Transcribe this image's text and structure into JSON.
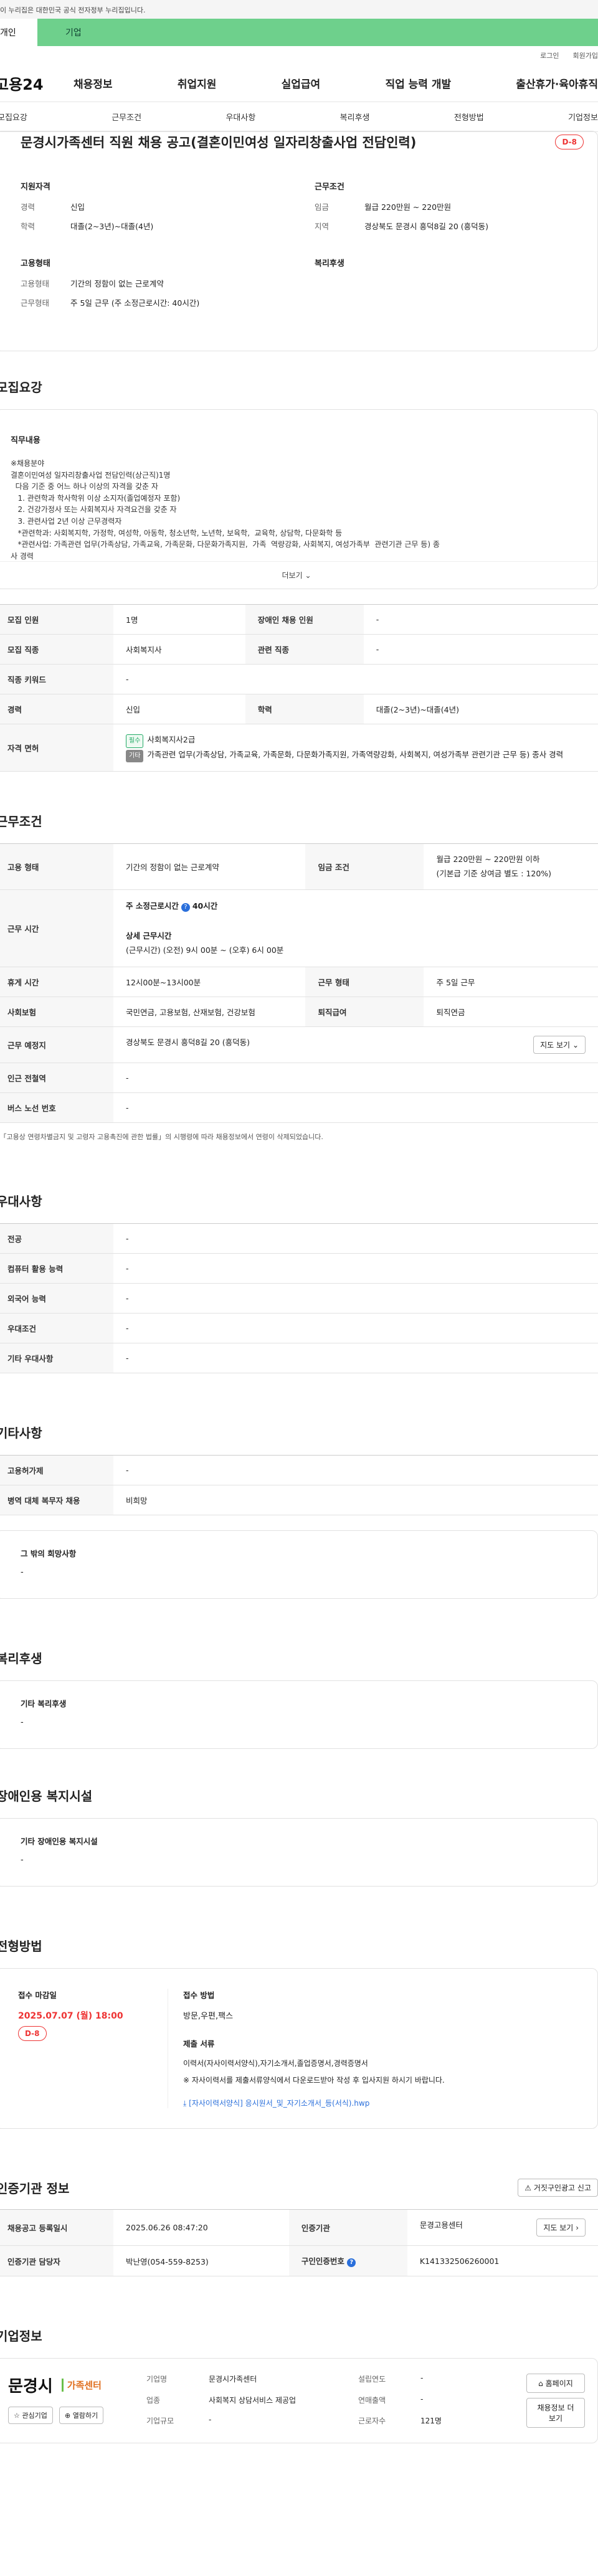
{
  "gov_banner": "이 누리집은 대한민국 공식 전자정부 누리집입니다.",
  "tabs": {
    "personal": "개인",
    "corporate": "기업"
  },
  "utility": {
    "login": "로그인",
    "signup": "회원가입"
  },
  "logo": "고용24",
  "gnb": [
    "채용정보",
    "취업지원",
    "실업급여",
    "직업 능력 개발",
    "출산휴가·육아휴직"
  ],
  "anchor_nav": [
    "모집요강",
    "근무조건",
    "우대사항",
    "복리후생",
    "전형방법",
    "기업정보"
  ],
  "hero": {
    "title": "문경시가족센터 직원 채용 공고(결혼이민여성 일자리창출사업 전담인력)",
    "dday": "D-8",
    "qualification_title": "지원자격",
    "career_label": "경력",
    "career": "신입",
    "education_label": "학력",
    "education": "대졸(2~3년)~대졸(4년)",
    "conditions_title": "근무조건",
    "wage_label": "임금",
    "wage": "월급 220만원 ~ 220만원",
    "region_label": "지역",
    "region": "경상북도 문경시 흥덕8길 20 (흥덕동)",
    "employment_title": "고용형태",
    "emptype_label": "고용형태",
    "emptype": "기간의 정함이 없는 근로계약",
    "worktype_label": "근무형태",
    "worktype": "주 5일 근무 (주 소정근로시간: 40시간)",
    "welfare_title": "복리후생"
  },
  "recruit": {
    "section_title": "모집요강",
    "job_title": "직무내용",
    "job_text": "※채용분야\n결혼이민여성 일자리창출사업 전담인력(상근직)1명\n  다음 기준 중 어느 하나 이상의 자격을 갖춘 자\n   1. 관련학과 학사학위 이상 소지자(졸업예정자 포함)\n   2. 건강가정사 또는 사회복지사 자격요건을 갖춘 자\n   3. 관련사업 2년 이상 근무경력자\n   *관련학과: 사회복지학, 가정학, 여성학, 아동학, 청소년학, 노년학, 보육학,  교육학, 상담학, 다문화학 등\n   *관련사업: 가족관련 업무(가족상담, 가족교육, 가족문화, 다문화가족지원,  가족  역량강화, 사회복지, 여성가족부  관련기관 근무 등) 종\n사 경력",
    "more_label": "더보기",
    "rows": [
      {
        "h1": "모집 인원",
        "v1": "1명",
        "h2": "장애인 채용 인원",
        "v2": "-"
      },
      {
        "h1": "모집 직종",
        "v1": "사회복지사",
        "h2": "관련 직종",
        "v2": "-"
      },
      {
        "h1": "직종 키워드",
        "v1": "-"
      },
      {
        "h1": "경력",
        "v1": "신입",
        "h2": "학력",
        "v2": "대졸(2~3년)~대졸(4년)"
      }
    ],
    "license_label": "자격 면허",
    "license_badge": "필수",
    "license_name": "사회복지사2급",
    "license_etc_badge": "기타",
    "license_etc": "가족관련 업무(가족상담, 가족교육, 가족문화, 다문화가족지원, 가족역량강화, 사회복지, 여성가족부 관련기관 근무 등) 종사 경력"
  },
  "work": {
    "section_title": "근무조건",
    "emptype_label": "고용 형태",
    "emptype": "기간의 정함이 없는 근로계약",
    "wage_label": "임금 조건",
    "wage": "월급 220만원 ~ 220만원 이하",
    "wage_note": "(기본급 기준 상여금 별도 : 120%)",
    "hours_label": "근무 시간",
    "weekly_hours": "주 소정근로시간",
    "weekly_hours_value": "40시간",
    "detail_hours_title": "상세 근무시간",
    "detail_hours": "(근무시간) (오전) 9시 00분 ~ (오후) 6시 00분",
    "break_label": "휴게 시간",
    "break": "12시00분~13시00분",
    "worktype_label": "근무 형태",
    "worktype": "주 5일 근무",
    "insurance_label": "사회보험",
    "insurance": "국민연금, 고용보험, 산재보험, 건강보험",
    "retire_label": "퇴직급여",
    "retire": "퇴직연금",
    "place_label": "근무 예정지",
    "place": "경상북도 문경시 흥덕8길 20 (흥덕동)",
    "map_button": "지도 보기",
    "subway_label": "인근 전철역",
    "subway": "-",
    "bus_label": "버스 노선 번호",
    "bus": "-",
    "note": "*「고용상 연령차별금지 및 고령자 고용촉진에 관한 법률」의 시행령에 따라 채용정보에서 연령이 삭제되었습니다."
  },
  "prefer": {
    "section_title": "우대사항",
    "rows": [
      {
        "h": "전공",
        "v": "-"
      },
      {
        "h": "컴퓨터 활용 능력",
        "v": "-"
      },
      {
        "h": "외국어 능력",
        "v": "-"
      },
      {
        "h": "우대조건",
        "v": "-"
      },
      {
        "h": "기타 우대사항",
        "v": "-"
      }
    ]
  },
  "etc": {
    "section_title": "기타사항",
    "rows": [
      {
        "h": "고용허가제",
        "v": "-"
      },
      {
        "h": "병역 대체 복무자 채용",
        "v": "비희망"
      }
    ],
    "other_title": "그 밖의 희망사항",
    "other_value": "-"
  },
  "welfare": {
    "section_title": "복리후생",
    "title": "기타 복리후생",
    "value": "-"
  },
  "disability": {
    "section_title": "장애인용 복지시설",
    "title": "기타 장애인용 복지시설",
    "value": "-"
  },
  "process": {
    "section_title": "전형방법",
    "deadline_title": "접수 마감일",
    "deadline": "2025.07.07 (월) 18:00",
    "dday": "D-8",
    "method_title": "접수 방법",
    "method": "방문,우편,팩스",
    "docs_title": "제출 서류",
    "docs": "이력서(자사이력서양식),자기소개서,졸업증명서,경력증명서",
    "docs_note": "※ 자사이력서를 제출서류양식에서 다운로드받아 작성 후 입사지원 하시기 바랍니다.",
    "docs_file": "[자사이력서양식] 응시원서_및_자기소개서_등(서식).hwp"
  },
  "agency": {
    "section_title": "인증기관 정보",
    "report_button": "거짓구인광고 신고",
    "reg_label": "채용공고 등록일시",
    "reg": "2025.06.26 08:47:20",
    "agency_label": "인증기관",
    "agency": "문경고용센터",
    "map_button": "지도 보기",
    "manager_label": "인증기관 담당자",
    "manager": "박난영(054-559-8253)",
    "cert_label": "구인인증번호",
    "cert": "K141332506260001"
  },
  "company": {
    "section_title": "기업정보",
    "logo_text": "문경시",
    "logo_sub": "가족센터",
    "interest_button": "관심기업",
    "follow_button": "열람하기",
    "name_label": "기업명",
    "name": "문경시가족센터",
    "industry_label": "업종",
    "industry": "사회복지 상담서비스 제공업",
    "scale_label": "기업규모",
    "scale": "-",
    "founded_label": "설립연도",
    "founded": "-",
    "sales_label": "연매출액",
    "sales": "-",
    "employees_label": "근로자수",
    "employees": "121명",
    "homepage_button": "홈페이지",
    "more_jobs_button": "채용정보 더보기"
  }
}
